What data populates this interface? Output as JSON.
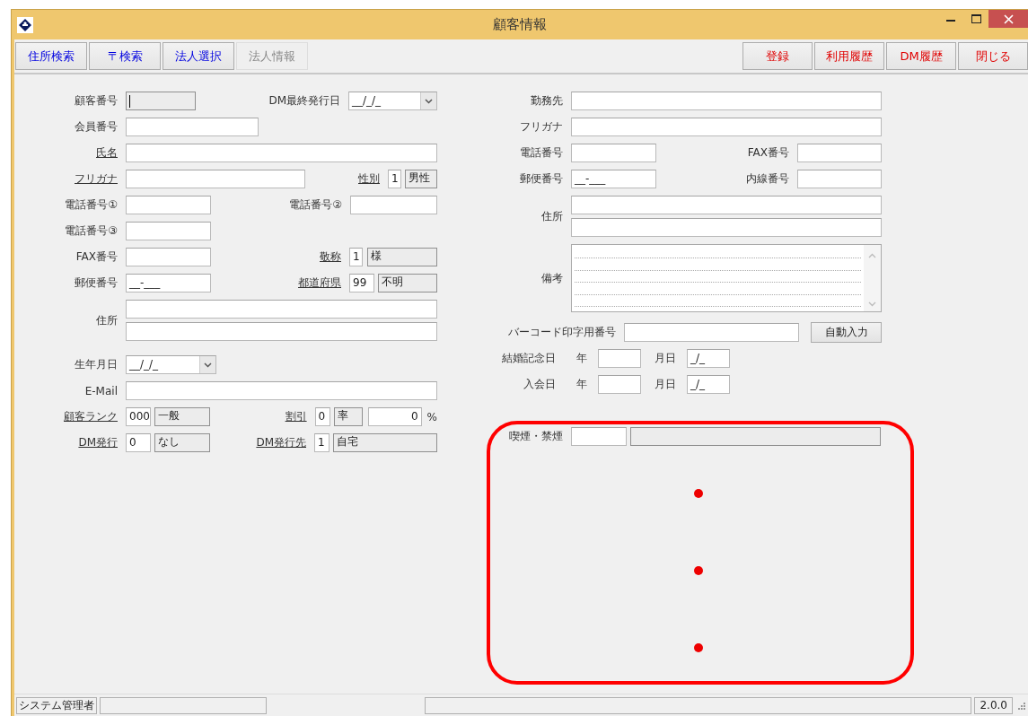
{
  "window": {
    "title": "顧客情報"
  },
  "toolbar": {
    "left": [
      {
        "label": "住所検索",
        "disabled": false
      },
      {
        "label": "〒検索",
        "disabled": false
      },
      {
        "label": "法人選択",
        "disabled": false
      },
      {
        "label": "法人情報",
        "disabled": true
      }
    ],
    "right": [
      {
        "label": "登録"
      },
      {
        "label": "利用履歴"
      },
      {
        "label": "DM履歴"
      },
      {
        "label": "閉じる"
      }
    ]
  },
  "customer": {
    "customer_no": {
      "label": "顧客番号",
      "lookup": false,
      "readonly": true,
      "focused": true
    },
    "dm_last_issue": {
      "label": "DM最終発行日",
      "lookup": false,
      "value": "__/_/_"
    },
    "member_no": {
      "label": "会員番号",
      "lookup": false
    },
    "name": {
      "label": "氏名",
      "lookup": true
    },
    "kana": {
      "label": "フリガナ",
      "lookup": true
    },
    "gender": {
      "label": "性別",
      "lookup": true,
      "code": "1",
      "name": "男性"
    },
    "phone1": {
      "label": "電話番号①",
      "lookup": false
    },
    "phone2": {
      "label": "電話番号②",
      "lookup": false
    },
    "phone3": {
      "label": "電話番号③",
      "lookup": false
    },
    "fax": {
      "label": "FAX番号",
      "lookup": false
    },
    "honorific": {
      "label": "敬称",
      "lookup": true,
      "code": "1",
      "name": "様"
    },
    "postal": {
      "label": "郵便番号",
      "lookup": false,
      "value": "__-___"
    },
    "prefecture": {
      "label": "都道府県",
      "lookup": true,
      "code": "99",
      "name": "不明"
    },
    "address": {
      "label": "住所",
      "lookup": false
    },
    "birthday": {
      "label": "生年月日",
      "lookup": false,
      "value": "__/_/_"
    },
    "email": {
      "label": "E-Mail",
      "lookup": false
    },
    "rank": {
      "label": "顧客ランク",
      "lookup": true,
      "code": "000",
      "name": "一般"
    },
    "discount": {
      "label": "割引",
      "lookup": true,
      "code": "0",
      "name": "率",
      "amount": "0",
      "unit": "%"
    },
    "dm_issue": {
      "label": "DM発行",
      "lookup": true,
      "code": "0",
      "name": "なし"
    },
    "dm_destination": {
      "label": "DM発行先",
      "lookup": true,
      "code": "1",
      "name": "自宅"
    }
  },
  "company": {
    "workplace": {
      "label": "勤務先"
    },
    "kana": {
      "label": "フリガナ"
    },
    "phone": {
      "label": "電話番号"
    },
    "fax": {
      "label": "FAX番号"
    },
    "postal": {
      "label": "郵便番号",
      "value": "__-___"
    },
    "extension": {
      "label": "内線番号"
    },
    "address": {
      "label": "住所"
    },
    "remarks": {
      "label": "備考"
    },
    "barcode": {
      "label": "バーコード印字用番号",
      "button": "自動入力"
    },
    "wedding": {
      "label": "結婚記念日",
      "year_label": "年",
      "month_day_label": "月日",
      "month_day": "_/_"
    },
    "joined": {
      "label": "入会日",
      "year_label": "年",
      "month_day_label": "月日",
      "month_day": "_/_"
    },
    "smoking": {
      "label": "喫煙・禁煙"
    }
  },
  "status_bar": {
    "user": "システム管理者",
    "version": "2.0.0"
  }
}
